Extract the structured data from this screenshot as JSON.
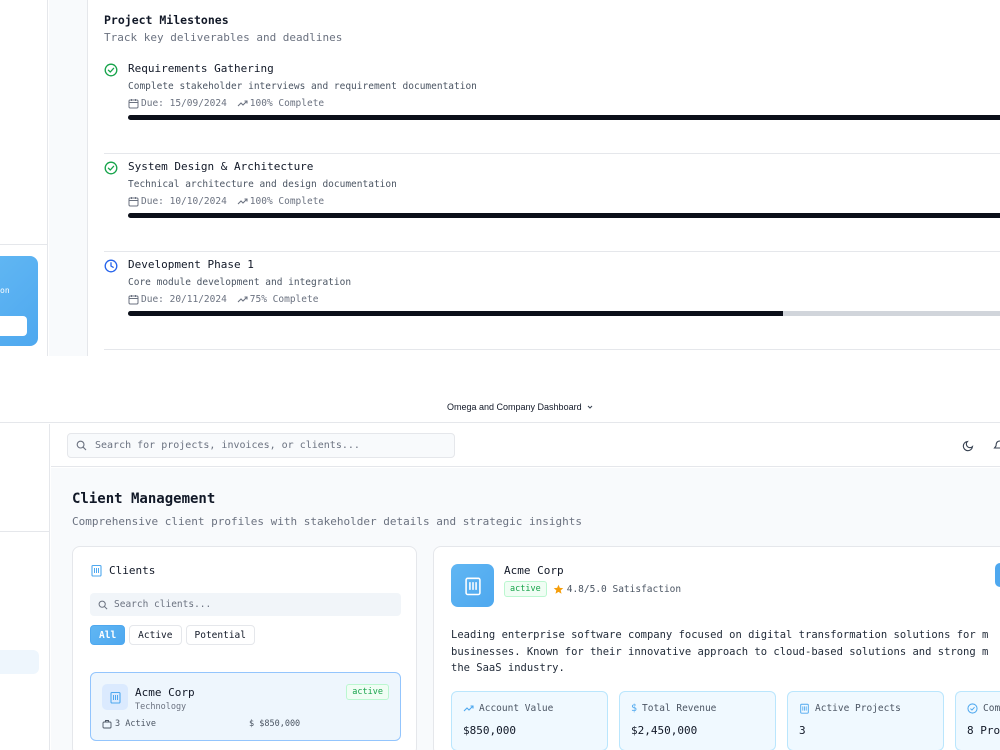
{
  "milestones": {
    "title": "Project Milestones",
    "subtitle": "Track key deliverables and deadlines",
    "items": [
      {
        "name": "Requirements Gathering",
        "description": "Complete stakeholder interviews and requirement documentation",
        "due": "Due: 15/09/2024",
        "complete_label": "100% Complete",
        "progress": 1.0,
        "status": "completed",
        "status_icon": "check-circle-icon",
        "status_color": "#16a34a"
      },
      {
        "name": "System Design & Architecture",
        "description": "Technical architecture and design documentation",
        "due": "Due: 10/10/2024",
        "complete_label": "100% Complete",
        "progress": 1.0,
        "status": "completed",
        "status_icon": "check-circle-icon",
        "status_color": "#16a34a"
      },
      {
        "name": "Development Phase 1",
        "description": "Core module development and integration",
        "due": "Due: 20/11/2024",
        "complete_label": "75% Complete",
        "progress": 0.75,
        "status": "in-progress",
        "status_icon": "clock-icon",
        "status_color": "#2563eb"
      }
    ]
  },
  "window": {
    "title": "Omega and Company Dashboard"
  },
  "search": {
    "placeholder": "Search for projects, invoices, or clients..."
  },
  "page": {
    "title": "Client Management",
    "subtitle": "Comprehensive client profiles with stakeholder details and strategic insights"
  },
  "clients_panel": {
    "heading": "Clients",
    "search_placeholder": "Search clients...",
    "filters": [
      {
        "label": "All",
        "active": true
      },
      {
        "label": "Active",
        "active": false
      },
      {
        "label": "Potential",
        "active": false
      }
    ],
    "selected_client": {
      "name": "Acme Corp",
      "industry": "Technology",
      "status": "active",
      "projects": "3 Active",
      "value": "$ $850,000"
    }
  },
  "client_detail": {
    "name": "Acme Corp",
    "status": "active",
    "satisfaction": "4.8/5.0 Satisfaction",
    "description_lines": [
      "Leading enterprise software company focused on digital transformation solutions for m",
      "businesses. Known for their innovative approach to cloud-based solutions and strong m",
      "the SaaS industry."
    ],
    "metrics": [
      {
        "label": "Account Value",
        "value": "$850,000",
        "icon": "trending-up-icon"
      },
      {
        "label": "Total Revenue",
        "value": "$2,450,000",
        "icon": "dollar-icon"
      },
      {
        "label": "Active Projects",
        "value": "3",
        "icon": "building-icon"
      },
      {
        "label": "Com",
        "value": "8 Pro",
        "icon": "check-circle-icon"
      }
    ]
  },
  "colors": {
    "accent": "#4ea8ef",
    "progress_fill": "#0b0f19",
    "success": "#16a34a",
    "star": "#f59e0b"
  }
}
